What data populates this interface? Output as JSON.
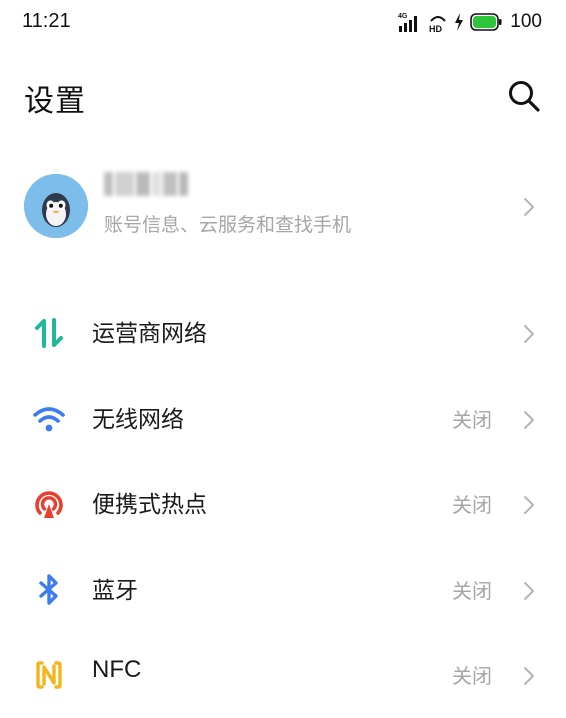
{
  "status_bar": {
    "time": "11:21",
    "network": "4G",
    "hd": "HD",
    "battery": "100",
    "colors": {
      "battery": "#2ec53a"
    }
  },
  "header": {
    "title": "设置",
    "search_icon": "search-icon"
  },
  "account": {
    "subtitle": "账号信息、云服务和查找手机",
    "avatar_icon": "penguin-avatar"
  },
  "settings": {
    "items": [
      {
        "label": "运营商网络",
        "status": "",
        "icon": "carrier-network-icon",
        "color": "#1fb89a"
      },
      {
        "label": "无线网络",
        "status": "关闭",
        "icon": "wifi-icon",
        "color": "#3d7bf0"
      },
      {
        "label": "便携式热点",
        "status": "关闭",
        "icon": "hotspot-icon",
        "color": "#e8402f"
      },
      {
        "label": "蓝牙",
        "status": "关闭",
        "icon": "bluetooth-icon",
        "color": "#3d7bf0"
      },
      {
        "label": "NFC",
        "status": "关闭",
        "icon": "nfc-icon",
        "color": "#f4b41a"
      }
    ]
  }
}
